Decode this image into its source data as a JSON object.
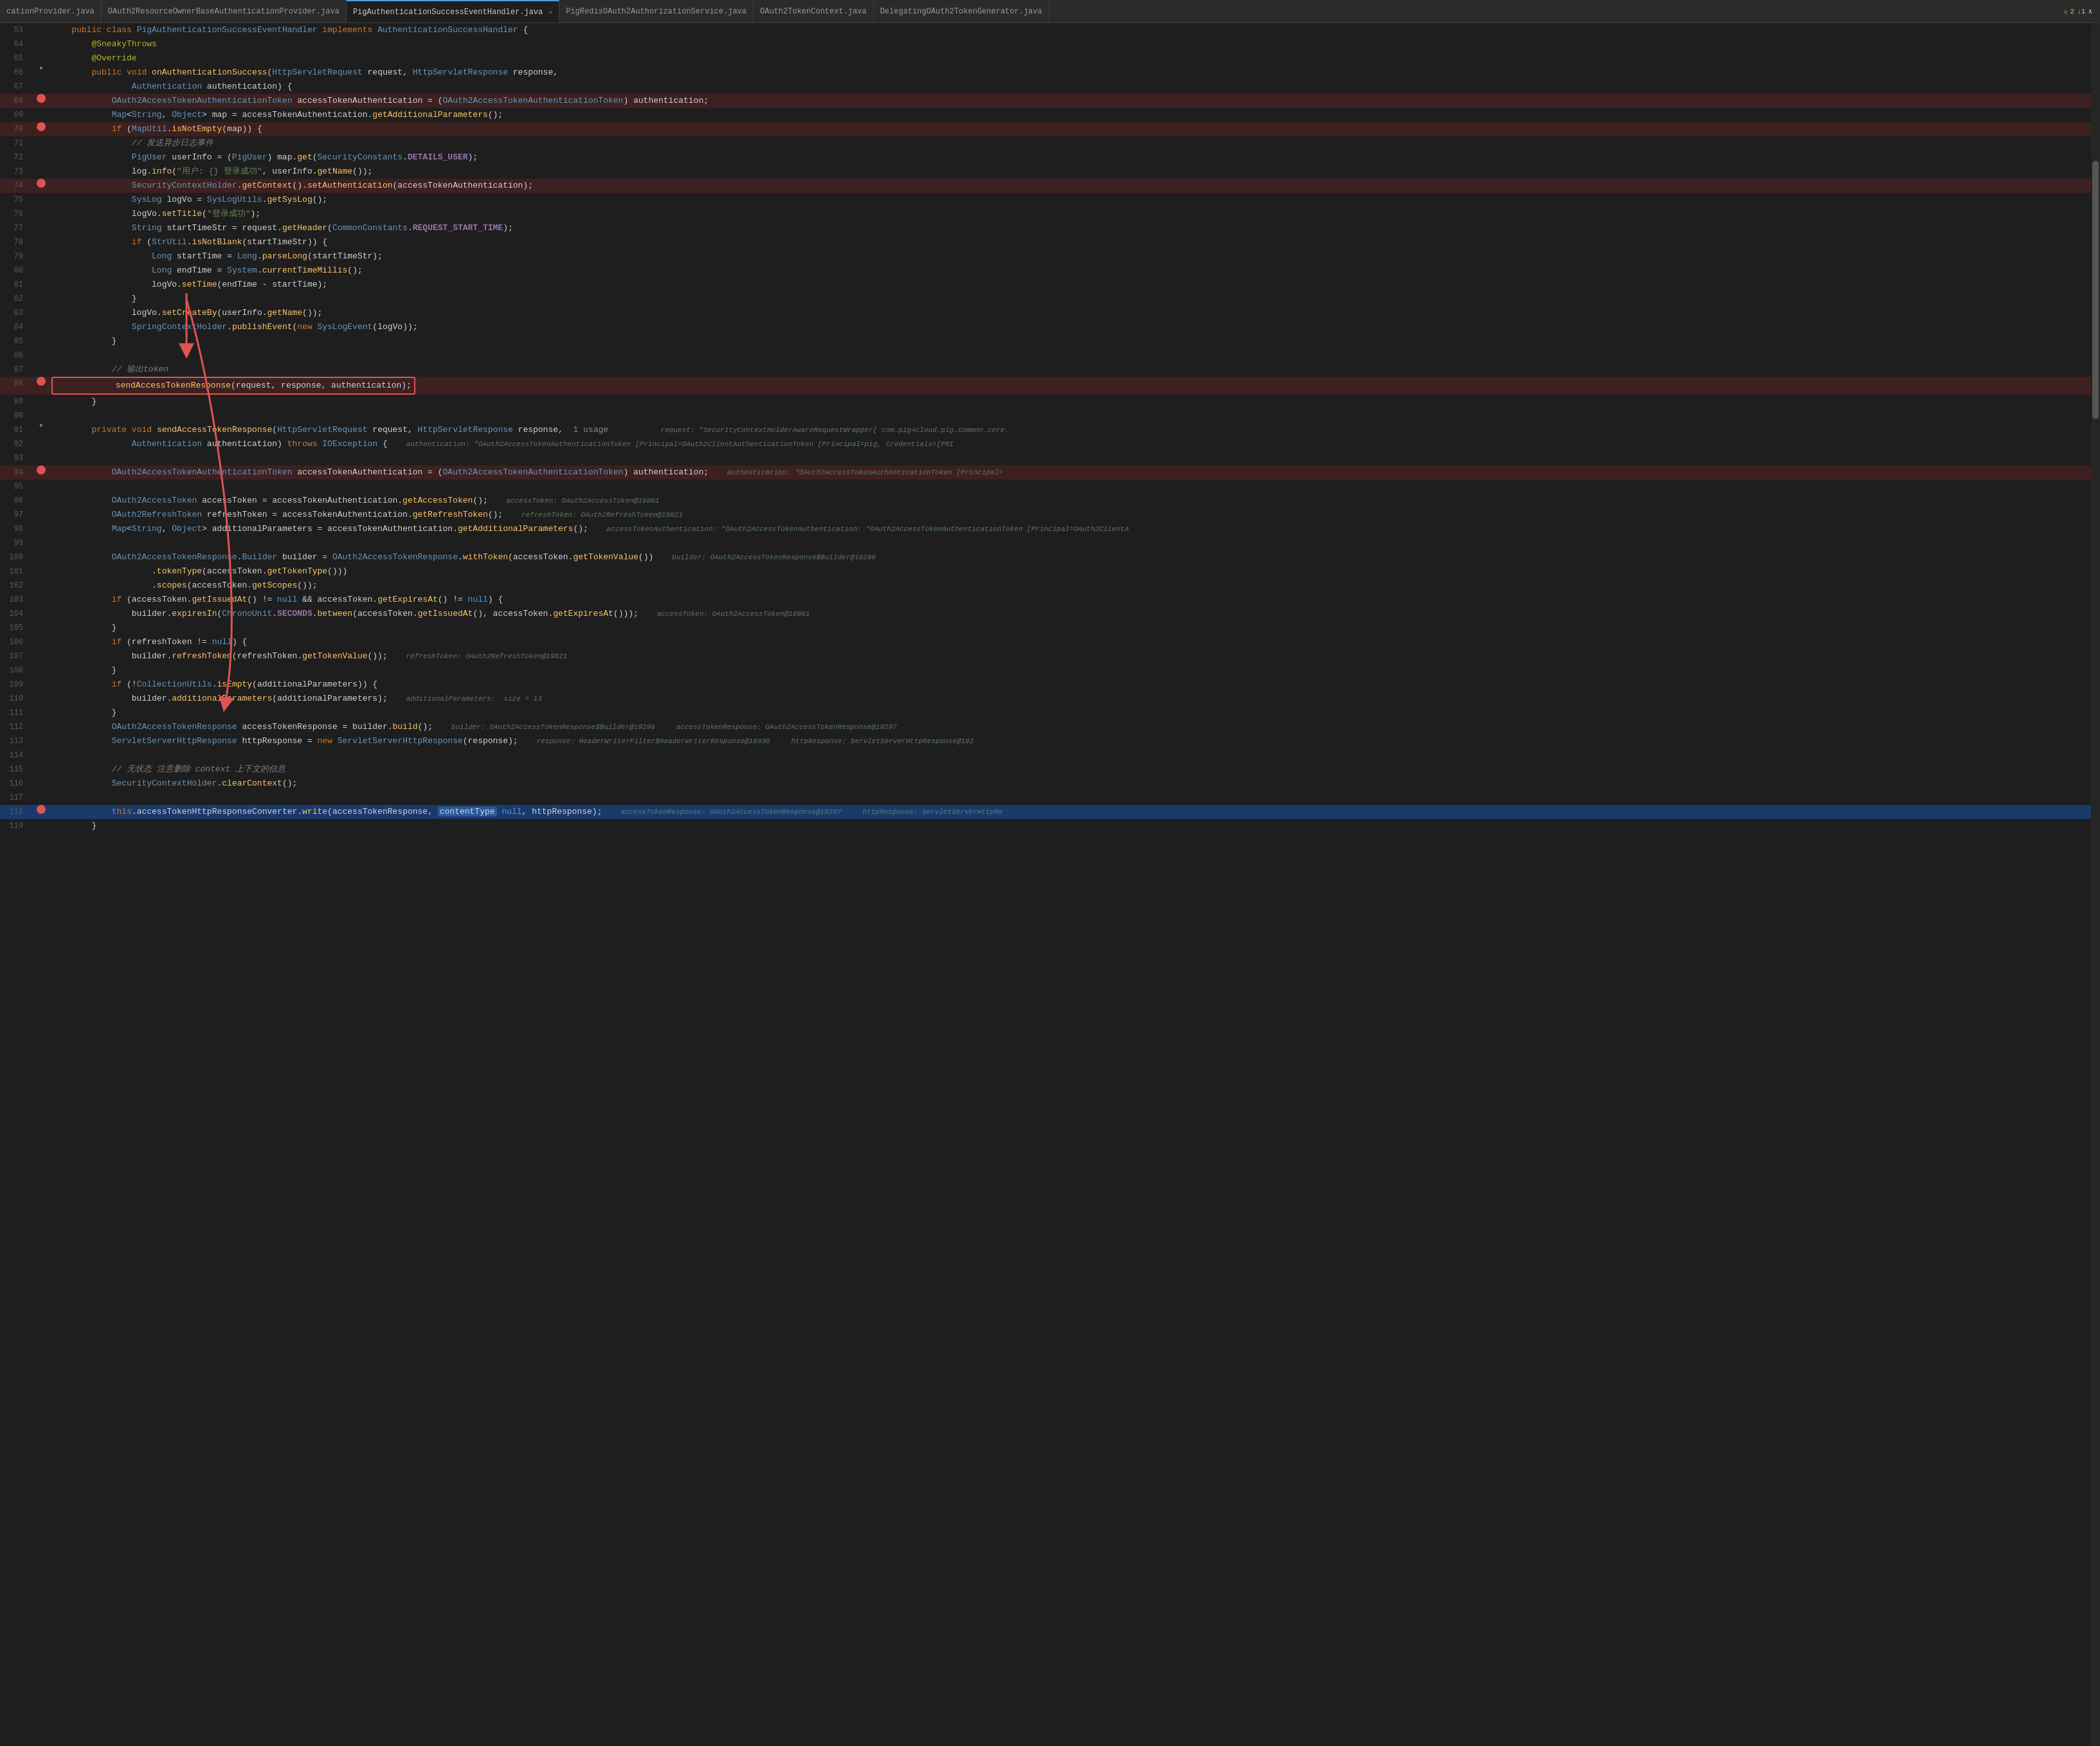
{
  "tabs": [
    {
      "label": "cationProvider.java",
      "active": false,
      "dot": false
    },
    {
      "label": "OAuth2ResourceOwnerBaseAuthenticationProvider.java",
      "active": false,
      "dot": false
    },
    {
      "label": "PigAuthenticationSuccessEventHandler.java",
      "active": true,
      "dot": false
    },
    {
      "label": "PigRedisOAuth2AuthorizationService.java",
      "active": false,
      "dot": false
    },
    {
      "label": "OAuth2TokenContext.java",
      "active": false,
      "dot": false
    },
    {
      "label": "DelegatingOAuth2TokenGenerator.java",
      "active": false,
      "dot": false
    }
  ],
  "warning_badge": "▲2  ↓1  ∧",
  "lines": [
    {
      "num": 53,
      "gutter": "",
      "code": "    public class PigAuthenticationSuccessEventHandler implements AuthenticationSuccessHandler {",
      "type": "normal"
    },
    {
      "num": 64,
      "gutter": "",
      "code": "        @SneakyThrows",
      "type": "normal"
    },
    {
      "num": 65,
      "gutter": "",
      "code": "        @Override",
      "type": "normal"
    },
    {
      "num": 66,
      "gutter": "method",
      "code": "        public void onAuthenticationSuccess(HttpServletRequest request, HttpServletResponse response,",
      "type": "normal"
    },
    {
      "num": 67,
      "gutter": "",
      "code": "                Authentication authentication) {",
      "type": "normal"
    },
    {
      "num": 68,
      "gutter": "bp",
      "code": "            OAuth2AccessTokenAuthenticationToken accessTokenAuthentication = (OAuth2AccessTokenAuthenticationToken) authentication;",
      "type": "red"
    },
    {
      "num": 69,
      "gutter": "",
      "code": "            Map<String, Object> map = accessTokenAuthentication.getAdditionalParameters();",
      "type": "normal"
    },
    {
      "num": 70,
      "gutter": "bp",
      "code": "            if (MapUtil.isNotEmpty(map)) {",
      "type": "red"
    },
    {
      "num": 71,
      "gutter": "",
      "code": "                // 发送异步日志事件",
      "type": "normal"
    },
    {
      "num": 72,
      "gutter": "",
      "code": "                PigUser userInfo = (PigUser) map.get(SecurityConstants.DETAILS_USER);",
      "type": "normal"
    },
    {
      "num": 73,
      "gutter": "",
      "code": "                log.info(\"用户: {} 登录成功\", userInfo.getName());",
      "type": "normal"
    },
    {
      "num": 74,
      "gutter": "bp",
      "code": "                SecurityContextHolder.getContext().setAuthentication(accessTokenAuthentication);",
      "type": "red"
    },
    {
      "num": 75,
      "gutter": "",
      "code": "                SysLog logVo = SysLogUtils.getSysLog();",
      "type": "normal"
    },
    {
      "num": 76,
      "gutter": "",
      "code": "                logVo.setTitle(\"登录成功\");",
      "type": "normal"
    },
    {
      "num": 77,
      "gutter": "",
      "code": "                String startTimeStr = request.getHeader(CommonConstants.REQUEST_START_TIME);",
      "type": "normal"
    },
    {
      "num": 78,
      "gutter": "",
      "code": "                if (StrUtil.isNotBlank(startTimeStr)) {",
      "type": "normal"
    },
    {
      "num": 79,
      "gutter": "",
      "code": "                    Long startTime = Long.parseLong(startTimeStr);",
      "type": "normal"
    },
    {
      "num": 80,
      "gutter": "",
      "code": "                    Long endTime = System.currentTimeMillis();",
      "type": "normal"
    },
    {
      "num": 81,
      "gutter": "",
      "code": "                    logVo.setTime(endTime - startTime);",
      "type": "normal"
    },
    {
      "num": 82,
      "gutter": "",
      "code": "                }",
      "type": "normal"
    },
    {
      "num": 83,
      "gutter": "",
      "code": "                logVo.setCreateBy(userInfo.getName());",
      "type": "normal"
    },
    {
      "num": 84,
      "gutter": "",
      "code": "                SpringContextHolder.publishEvent(new SysLogEvent(logVo));",
      "type": "normal"
    },
    {
      "num": 85,
      "gutter": "",
      "code": "            }",
      "type": "normal"
    },
    {
      "num": 86,
      "gutter": "",
      "code": "",
      "type": "normal"
    },
    {
      "num": 87,
      "gutter": "",
      "code": "            // 输出token",
      "type": "normal"
    },
    {
      "num": 88,
      "gutter": "bp",
      "code": "            sendAccessTokenResponse(request, response, authentication);",
      "type": "red_box"
    },
    {
      "num": 89,
      "gutter": "",
      "code": "        }",
      "type": "normal"
    },
    {
      "num": 90,
      "gutter": "",
      "code": "",
      "type": "normal"
    },
    {
      "num": 91,
      "gutter": "method",
      "code": "        private void sendAccessTokenResponse(HttpServletRequest request, HttpServletResponse response,  1 usage",
      "type": "normal",
      "hint": "  request: \"SecurityContextHolderAwareRequestWrapper[ com.pig4cloud.pig.common.core."
    },
    {
      "num": 92,
      "gutter": "",
      "code": "                Authentication authentication) throws IOException {  ",
      "type": "normal",
      "hint": "  authentication: \"OAuth2AccessTokenAuthenticationToken [Principal=OAuth2ClientAuthenticationToken [Principal=pig, Credentials=[PRI"
    },
    {
      "num": 93,
      "gutter": "",
      "code": "",
      "type": "normal"
    },
    {
      "num": 94,
      "gutter": "bp",
      "code": "            OAuth2AccessTokenAuthenticationToken accessTokenAuthentication = (OAuth2AccessTokenAuthenticationToken) authentication;  ",
      "type": "red",
      "hint": "  authentication: \"OAuth2AccessTokenAuthenticationToken [Principal="
    },
    {
      "num": 95,
      "gutter": "",
      "code": "",
      "type": "normal"
    },
    {
      "num": 96,
      "gutter": "",
      "code": "            OAuth2AccessToken accessToken = accessTokenAuthentication.getAccessToken();  ",
      "type": "normal",
      "hint": "  accessToken: OAuth2AccessToken@19801"
    },
    {
      "num": 97,
      "gutter": "",
      "code": "            OAuth2RefreshToken refreshToken = accessTokenAuthentication.getRefreshToken();  ",
      "type": "normal",
      "hint": "  refreshToken: OAuth2RefreshToken@19821"
    },
    {
      "num": 98,
      "gutter": "",
      "code": "            Map<String, Object> additionalParameters = accessTokenAuthentication.getAdditionalParameters();  ",
      "type": "normal",
      "hint": "  accessTokenAuthentication: \"OAuth2AccessTokenAuthentication: \"OAuth2AccessTokenAuthenticationToken [Principal=OAuth2ClientA"
    },
    {
      "num": 99,
      "gutter": "",
      "code": "",
      "type": "normal"
    },
    {
      "num": 100,
      "gutter": "",
      "code": "            OAuth2AccessTokenResponse.Builder builder = OAuth2AccessTokenResponse.withToken(accessToken.getTokenValue())  ",
      "type": "normal",
      "hint": "  builder: OAuth2AccessTokenResponse$Builder@19296"
    },
    {
      "num": 101,
      "gutter": "",
      "code": "                    .tokenType(accessToken.getTokenType()))",
      "type": "normal"
    },
    {
      "num": 102,
      "gutter": "",
      "code": "                    .scopes(accessToken.getScopes());",
      "type": "normal"
    },
    {
      "num": 103,
      "gutter": "",
      "code": "            if (accessToken.getIssuedAt() != null && accessToken.getExpiresAt() != null) {",
      "type": "normal"
    },
    {
      "num": 104,
      "gutter": "",
      "code": "                builder.expiresIn(ChronoUnit.SECONDS.between(accessToken.getIssuedAt(), accessToken.getExpiresAt()));  ",
      "type": "normal",
      "hint": "  accessToken: OAuth2AccessToken@19801"
    },
    {
      "num": 105,
      "gutter": "",
      "code": "            }",
      "type": "normal"
    },
    {
      "num": 106,
      "gutter": "",
      "code": "            if (refreshToken != null) {",
      "type": "normal"
    },
    {
      "num": 107,
      "gutter": "",
      "code": "                builder.refreshToken(refreshToken.getTokenValue());  ",
      "type": "normal",
      "hint": "  refreshToken: OAuth2RefreshToken@19821"
    },
    {
      "num": 108,
      "gutter": "",
      "code": "            }",
      "type": "normal"
    },
    {
      "num": 109,
      "gutter": "",
      "code": "            if (!CollectionUtils.isEmpty(additionalParameters)) {",
      "type": "normal"
    },
    {
      "num": 110,
      "gutter": "",
      "code": "                builder.additionalParameters(additionalParameters);  ",
      "type": "normal",
      "hint": "  additionalParameters:  size = 13"
    },
    {
      "num": 111,
      "gutter": "",
      "code": "            }",
      "type": "normal"
    },
    {
      "num": 112,
      "gutter": "",
      "code": "            OAuth2AccessTokenResponse accessTokenResponse = builder.build();  ",
      "type": "normal",
      "hint": "  builder: OAuth2AccessTokenResponse$Builder@19296     accessTokenResponse: OAuth2AccessTokenResponse@19297"
    },
    {
      "num": 113,
      "gutter": "",
      "code": "            ServletServerHttpResponse httpResponse = new ServletServerHttpResponse(response);  ",
      "type": "normal",
      "hint": "  response: HeaderWriterFilter$HeaderWriterResponse@18830     httpResponse: ServletServerHttpResponse@192"
    },
    {
      "num": 114,
      "gutter": "",
      "code": "",
      "type": "normal"
    },
    {
      "num": 115,
      "gutter": "",
      "code": "            // 无状态 注意删除 context 上下文的信息",
      "type": "normal"
    },
    {
      "num": 116,
      "gutter": "",
      "code": "            SecurityContextHolder.clearContext();",
      "type": "normal"
    },
    {
      "num": 117,
      "gutter": "",
      "code": "",
      "type": "normal"
    },
    {
      "num": 118,
      "gutter": "bp",
      "code": "            this.accessTokenHttpResponseConverter.write(accessTokenResponse, contentType null, httpResponse);  ",
      "type": "blue_bottom",
      "hint": "  accessTokenResponse: OAuth2AccessTokenResponse@19297     httpResponse: ServletServerHttpRe"
    },
    {
      "num": 119,
      "gutter": "",
      "code": "        }",
      "type": "normal"
    }
  ]
}
